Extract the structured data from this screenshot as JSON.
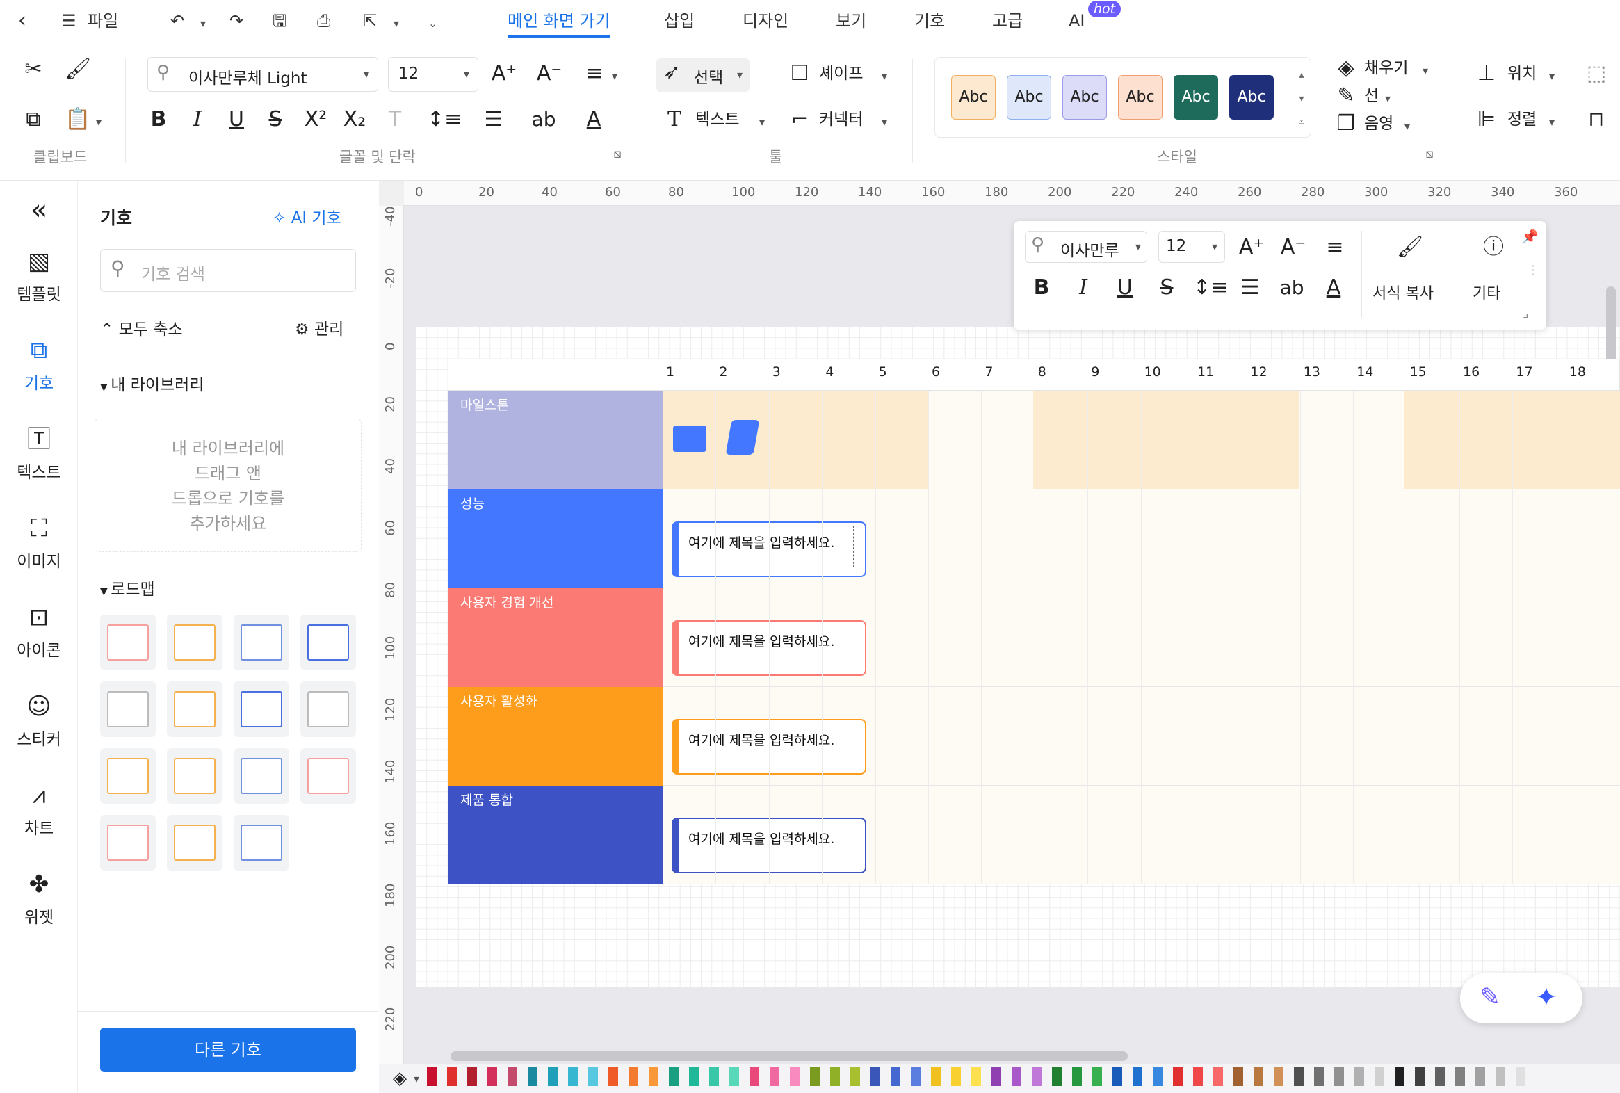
{
  "menubar": {
    "file": "파일",
    "tabs": [
      "메인 화면 가기",
      "삽입",
      "디자인",
      "보기",
      "기호",
      "고급",
      "AI"
    ],
    "hot": "hot"
  },
  "ribbon": {
    "font_name": "이사만루체 Light",
    "font_size": "12",
    "select": "선택",
    "shape": "셰이프",
    "text": "텍스트",
    "connector": "커넥터",
    "style_label": "Abc",
    "fill": "채우기",
    "line": "선",
    "shadow": "음영",
    "position": "위치",
    "align": "정렬",
    "groups": {
      "clipboard": "클립보드",
      "font": "글꼴 및 단락",
      "tools": "툴",
      "style": "스타일"
    },
    "style_colors": [
      {
        "bg": "#fde9cf",
        "border": "#f0b060",
        "fg": "#222"
      },
      {
        "bg": "#dfe8fb",
        "border": "#8fb0f0",
        "fg": "#222"
      },
      {
        "bg": "#dcdcf8",
        "border": "#9b9be8",
        "fg": "#222"
      },
      {
        "bg": "#fde0cf",
        "border": "#f0a070",
        "fg": "#222"
      },
      {
        "bg": "#1e6b5c",
        "border": "#1e6b5c",
        "fg": "#fff"
      },
      {
        "bg": "#1f2f7a",
        "border": "#1f2f7a",
        "fg": "#fff"
      }
    ]
  },
  "rail": [
    "템플릿",
    "기호",
    "텍스트",
    "이미지",
    "아이콘",
    "스티커",
    "차트",
    "위젯"
  ],
  "panel": {
    "title": "기호",
    "ai_symbol": "AI 기호",
    "search_placeholder": "기호 검색",
    "collapse_all": "모두 축소",
    "manage": "관리",
    "my_library": "내 라이브러리",
    "drop_hint": [
      "내 라이브러리에",
      "드래그 앤",
      "드롭으로 기호를",
      "추가하세요"
    ],
    "roadmap": "로드맵",
    "more_symbols": "다른 기호"
  },
  "rulers": {
    "h": [
      "0",
      "20",
      "40",
      "60",
      "80",
      "100",
      "120",
      "140",
      "160",
      "180",
      "200",
      "220",
      "240",
      "260",
      "280",
      "300",
      "320",
      "340",
      "360"
    ],
    "v": [
      "-40",
      "-20",
      "0",
      "20",
      "40",
      "60",
      "80",
      "100",
      "120",
      "140",
      "160",
      "180",
      "200",
      "220"
    ]
  },
  "timeline": [
    "1",
    "2",
    "3",
    "4",
    "5",
    "6",
    "7",
    "8",
    "9",
    "10",
    "11",
    "12",
    "13",
    "14",
    "15",
    "16",
    "17",
    "18"
  ],
  "roadmap_rows": [
    {
      "label": "마일스톤",
      "color": "#b0b3e0"
    },
    {
      "label": "성능",
      "color": "#4477ff",
      "card": "여기에 제목을 입력하세요.",
      "card_color": "#4477ff"
    },
    {
      "label": "사용자 경험 개선",
      "color": "#fb7a74",
      "card": "여기에 제목을 입력하세요.",
      "card_color": "#fb7a74"
    },
    {
      "label": "사용자 활성화",
      "color": "#fe9c1c",
      "card": "여기에 제목을 입력하세요.",
      "card_color": "#fe9c1c"
    },
    {
      "label": "제품 통합",
      "color": "#3d52c4",
      "card": "여기에 제목을 입력하세요.",
      "card_color": "#3d52c4"
    }
  ],
  "float_toolbar": {
    "font_name": "이사만루",
    "font_size": "12",
    "format_painter": "서식 복사",
    "more": "기타"
  },
  "palette": [
    "#c8102e",
    "#e0302e",
    "#b22030",
    "#d42e5a",
    "#c44a6e",
    "#1a8aa0",
    "#20a0b8",
    "#38b8d0",
    "#58c8e0",
    "#f05a28",
    "#f47a30",
    "#f89838",
    "#1aa080",
    "#20b898",
    "#38c8a8",
    "#58d8b8",
    "#e8487a",
    "#f068a0",
    "#f88ac0",
    "#7a9a20",
    "#90b028",
    "#a8c030",
    "#3a56b8",
    "#4468d0",
    "#5a7ee0",
    "#f0c020",
    "#f8d030",
    "#fde050",
    "#9040b0",
    "#a858c8",
    "#c078d8",
    "#208030",
    "#289840",
    "#38b050",
    "#1a5ab8",
    "#2070d0",
    "#3888e0",
    "#e03030",
    "#f04848",
    "#f86868",
    "#a06030",
    "#b87840",
    "#d09058",
    "#505050",
    "#707070",
    "#909090",
    "#b0b0b0",
    "#d0d0d0",
    "#202020",
    "#404040",
    "#606060",
    "#808080",
    "#a0a0a0",
    "#c0c0c0",
    "#e0e0e0"
  ]
}
